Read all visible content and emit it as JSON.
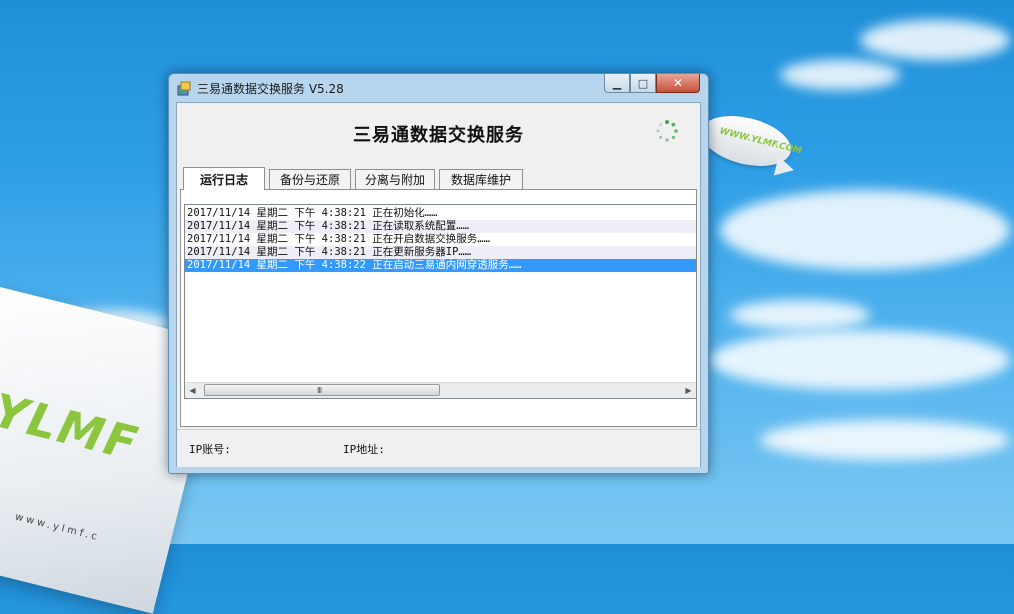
{
  "desktop": {
    "logo_text": "YLMF",
    "url_text": "www.ylmf.c",
    "blimp_text": "WWW.YLMF.COM"
  },
  "window": {
    "title": "三易通数据交换服务 V5.28",
    "heading": "三易通数据交换服务",
    "controls": {
      "minimize": "▁",
      "maximize": "□",
      "close": "✕"
    }
  },
  "tabs": [
    {
      "label": "运行日志",
      "active": true
    },
    {
      "label": "备份与还原",
      "active": false
    },
    {
      "label": "分离与附加",
      "active": false
    },
    {
      "label": "数据库维护",
      "active": false
    }
  ],
  "log": [
    "2017/11/14 星期二 下午 4:38:21 正在初始化……",
    "2017/11/14 星期二 下午 4:38:21 正在读取系统配置……",
    "2017/11/14 星期二 下午 4:38:21 正在开启数据交换服务……",
    "2017/11/14 星期二 下午 4:38:21 正在更新服务器IP……",
    "2017/11/14 星期二 下午 4:38:22 正在启动三易通内网穿透服务……"
  ],
  "scrollbar": {
    "grip": "III",
    "left_arrow": "◀",
    "right_arrow": "▶"
  },
  "status": {
    "ip_account_label": "IP账号:",
    "ip_address_label": "IP地址:"
  },
  "colors": {
    "selection": "#3399ff",
    "window_frame": "#b7d6ee"
  }
}
